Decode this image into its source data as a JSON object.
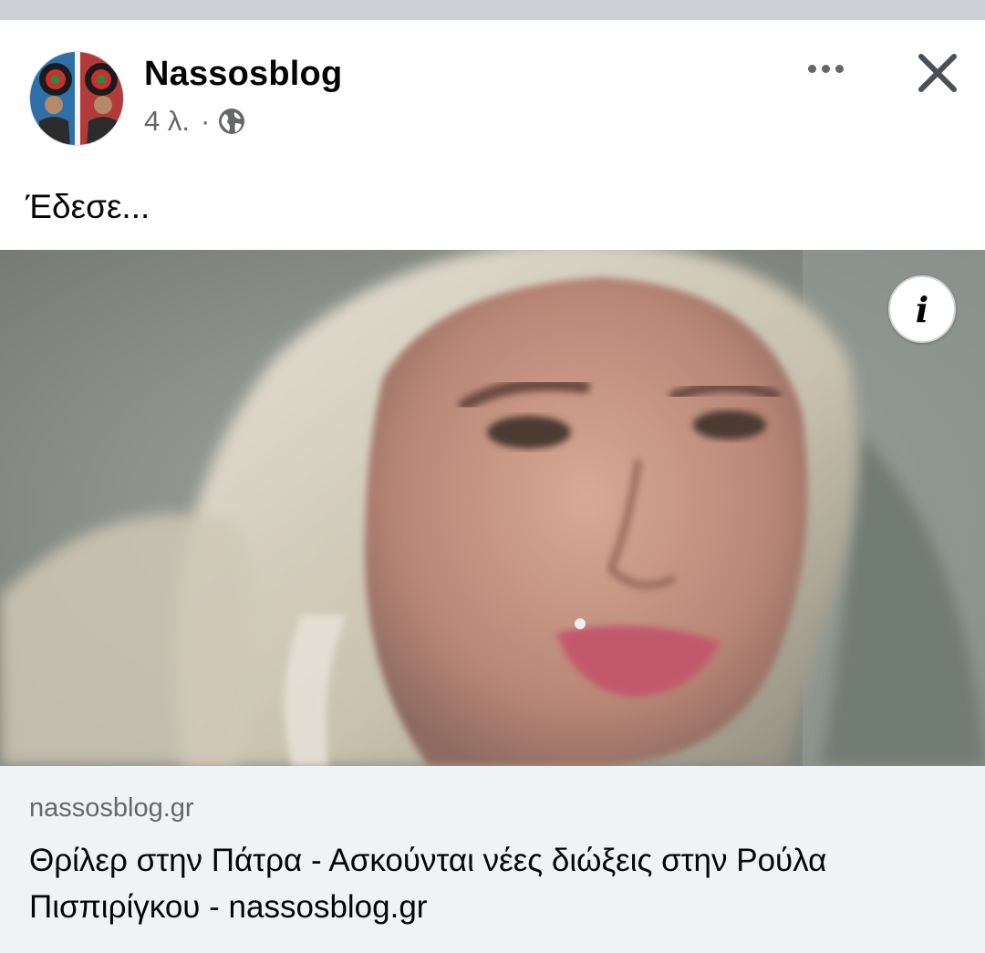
{
  "post": {
    "author": "Nassosblog",
    "time": "4 λ.",
    "separator": "·",
    "audience_icon": "globe-icon",
    "text": "Έδεσε...",
    "more_icon": "more-options-icon",
    "close_icon": "close-icon"
  },
  "media": {
    "info_label": "i"
  },
  "link_preview": {
    "domain": "nassosblog.gr",
    "title": "Θρίλερ στην Πάτρα - Ασκούνται νέες διώξεις στην Ρούλα Πισπιρίγκου - nassosblog.gr"
  },
  "colors": {
    "secondary_text": "#65676b",
    "preview_bg": "#f0f2f5",
    "top_band": "#cdd0d4"
  }
}
